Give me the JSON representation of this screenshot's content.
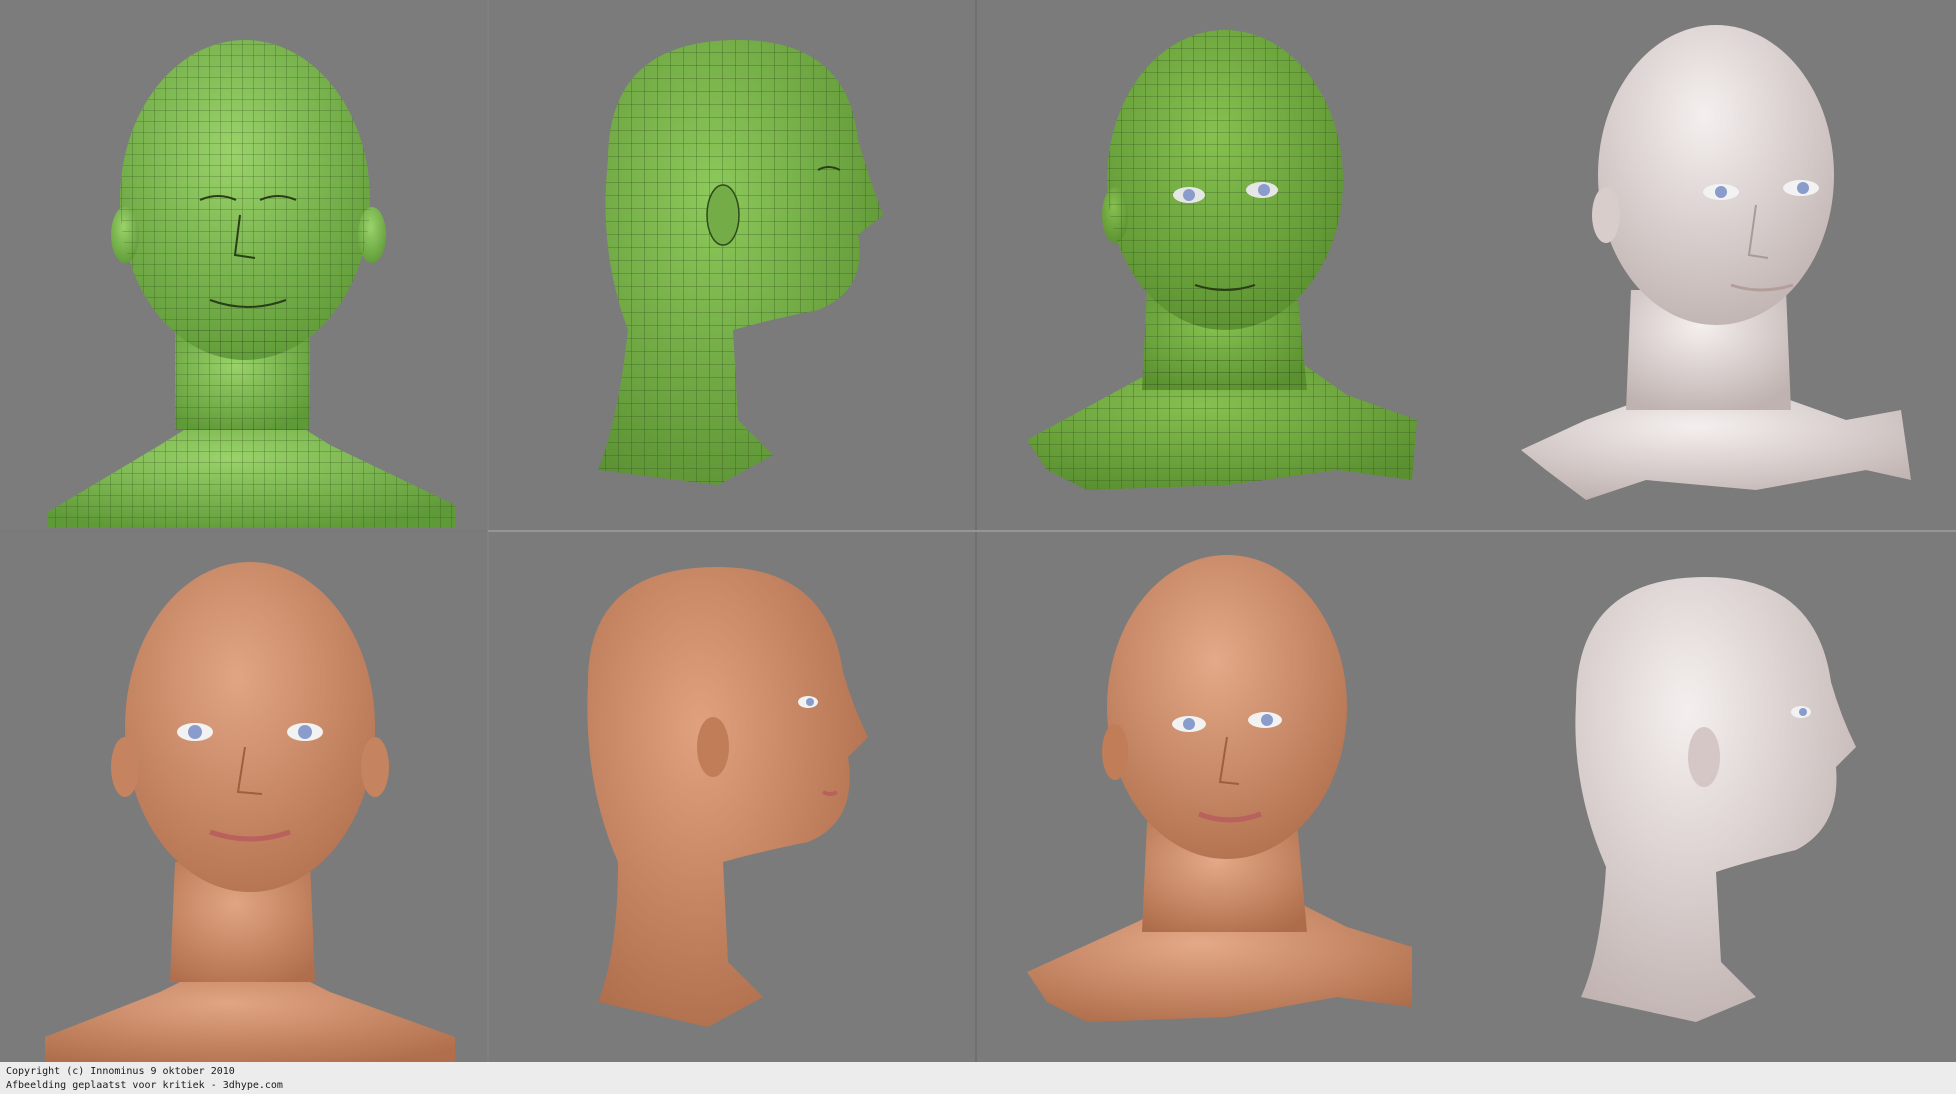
{
  "background_color": "#7a7a7a",
  "palette": {
    "wireframe_green": "#7fbf4d",
    "wire_line": "#2f4a1d",
    "skin": "#c98a66",
    "clay": "#e8dedd",
    "iris": "#8a9ccc"
  },
  "panels": [
    {
      "row": 1,
      "column": 1,
      "subject": "wireframe-head-front"
    },
    {
      "row": 1,
      "column": 2,
      "subject": "wireframe-head-side"
    },
    {
      "row": 1,
      "column": 3,
      "subject": "wireframe-head-three-quarter"
    },
    {
      "row": 1,
      "column": 4,
      "subject": "clay-head-three-quarter"
    },
    {
      "row": 2,
      "column": 1,
      "subject": "skin-head-front"
    },
    {
      "row": 2,
      "column": 2,
      "subject": "skin-head-side"
    },
    {
      "row": 2,
      "column": 3,
      "subject": "skin-head-three-quarter"
    },
    {
      "row": 2,
      "column": 4,
      "subject": "clay-head-side"
    }
  ],
  "footer": {
    "line1": "Copyright (c) Innominus 9 oktober 2010",
    "line2": "Afbeelding geplaatst voor kritiek - 3dhype.com"
  }
}
